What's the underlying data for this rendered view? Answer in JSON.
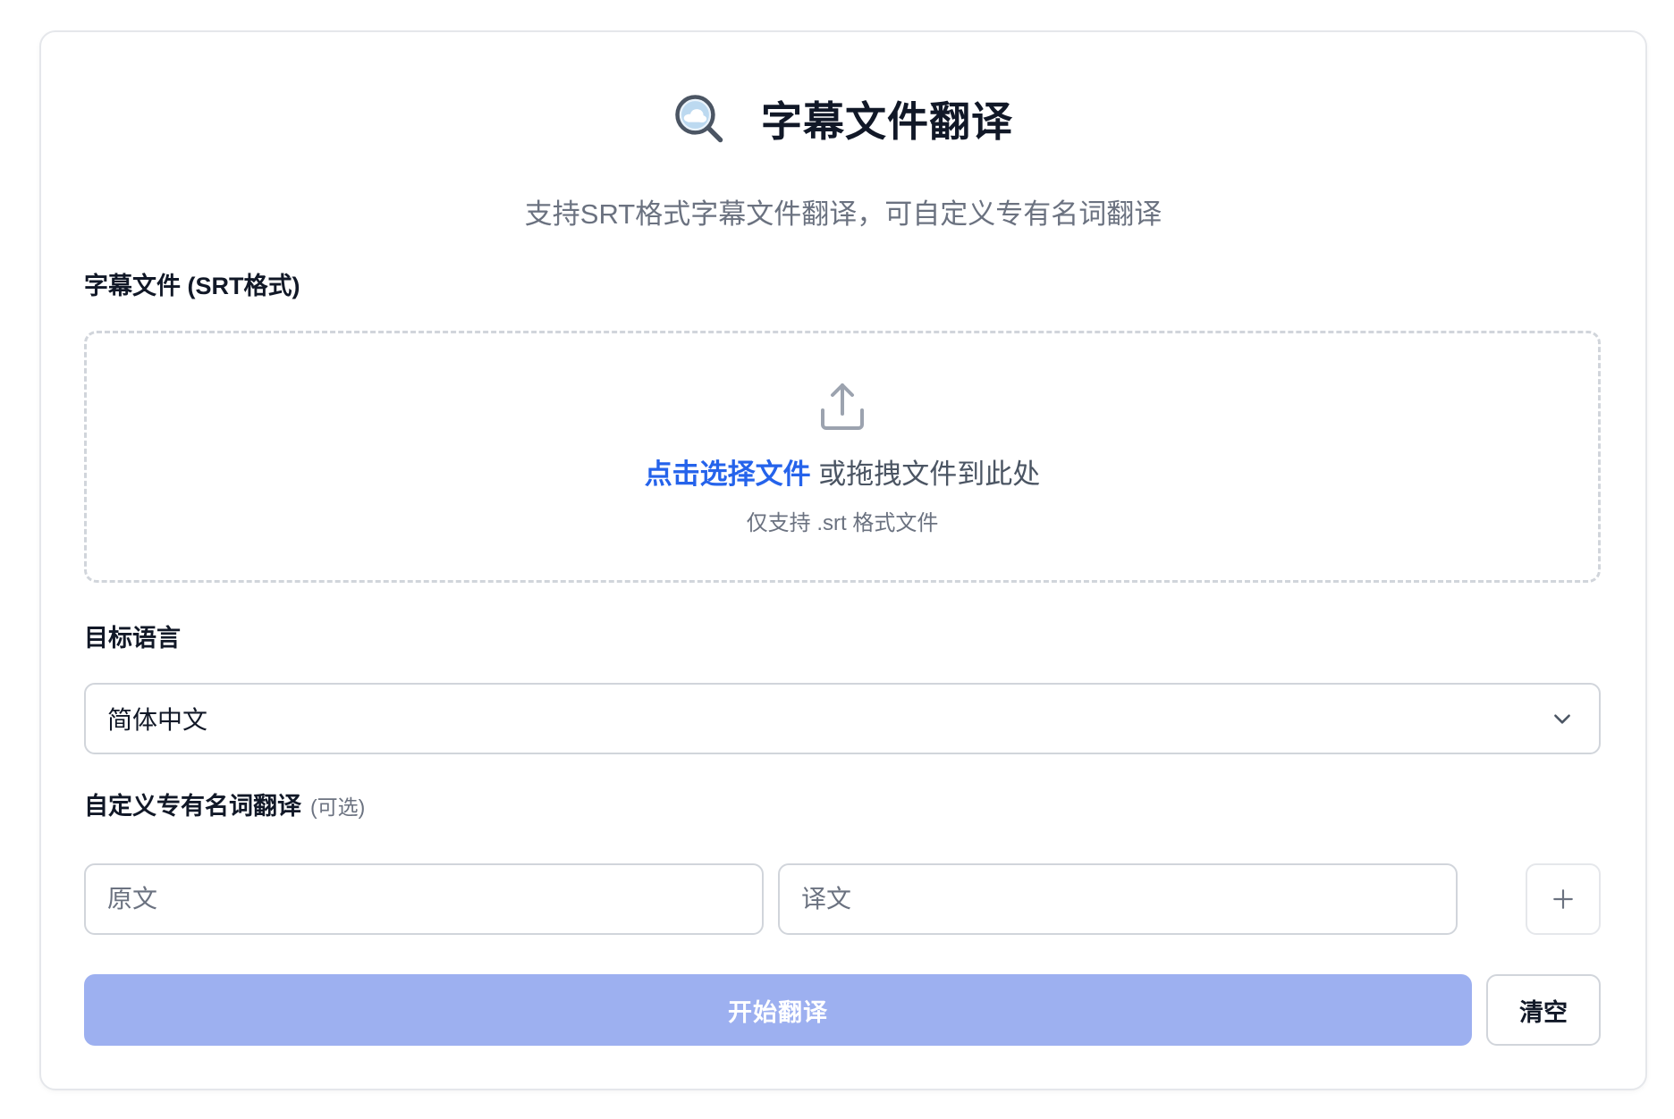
{
  "header": {
    "icon": "magnifier-cloud-icon",
    "title": "字幕文件翻译",
    "subtitle": "支持SRT格式字幕文件翻译，可自定义专有名词翻译"
  },
  "upload": {
    "label": "字幕文件 (SRT格式)",
    "icon": "upload-icon",
    "pick_link": "点击选择文件",
    "drag_text": " 或拖拽文件到此处",
    "hint": "仅支持 .srt 格式文件"
  },
  "language": {
    "label": "目标语言",
    "selected": "简体中文"
  },
  "glossary": {
    "label": "自定义专有名词翻译",
    "optional": "(可选)",
    "source_placeholder": "原文",
    "target_placeholder": "译文",
    "add_icon": "plus-icon"
  },
  "actions": {
    "start_label": "开始翻译",
    "clear_label": "清空"
  },
  "colors": {
    "accent": "#2563eb",
    "primary_disabled": "#9db0f0",
    "border": "#d1d5db",
    "muted_text": "#6b7280"
  }
}
